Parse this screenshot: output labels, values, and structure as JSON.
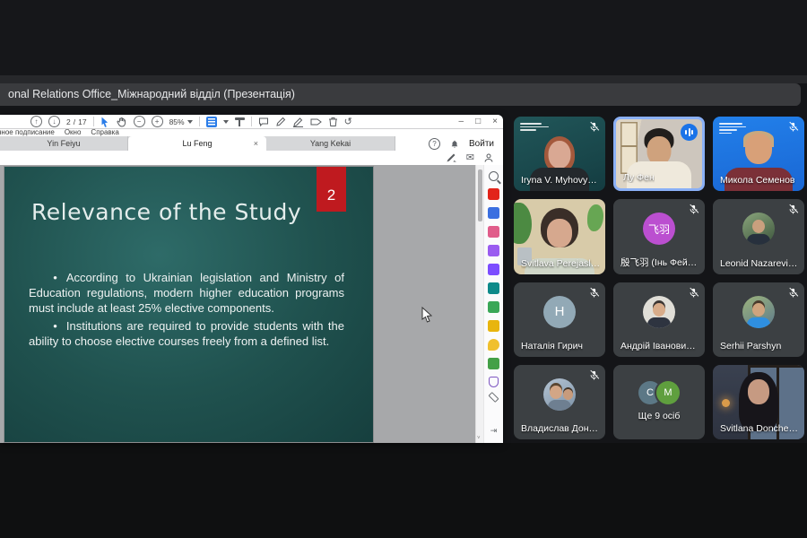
{
  "share_header": {
    "title": "onal Relations Office_Міжнародний відділ (Презентація)"
  },
  "acrobat": {
    "menu_items": [
      "нное подписание",
      "Окно",
      "Справка"
    ],
    "tabs": [
      {
        "label": "Yin Feiyu",
        "active": false
      },
      {
        "label": "Lu Feng",
        "active": true
      },
      {
        "label": "Yang Kekai",
        "active": false
      }
    ],
    "toolbar": {
      "page_current": "2",
      "page_separator": "/",
      "page_total": "17",
      "zoom_level": "85%"
    },
    "signin_label": "Войти",
    "glyphs": {
      "win_min": "–",
      "win_max": "□",
      "win_close": "×",
      "tab_close": "×",
      "help": "?",
      "page_up": "↑",
      "page_down": "↓",
      "zoom_out": "−",
      "zoom_in": "+",
      "undo": "↺",
      "envelope": "✉",
      "scroll_down": "˅",
      "rail_collapse": "⇥"
    },
    "right_rail_icons": [
      "search",
      "export-pdf",
      "create-pdf",
      "combine-files",
      "organize-pages",
      "fill-and-sign",
      "export-convert",
      "compress-pdf",
      "edit-pdf",
      "comments",
      "print-production",
      "protect",
      "measure"
    ]
  },
  "slide": {
    "page_badge": "2",
    "title": "Relevance of the Study",
    "bullet_char": "•",
    "bullets": [
      "According to Ukrainian legislation and Ministry of Education regulations, modern higher education programs must include at least 25% elective components.",
      "Institutions are required to provide students with the ability to choose elective courses freely from a defined list."
    ]
  },
  "participants": [
    {
      "name": "Iryna V. Myhovy…",
      "muted": true,
      "video": true
    },
    {
      "name": "Лу Фен",
      "muted": false,
      "speaking": true,
      "video": true,
      "accent": "#1a73e8",
      "border": "#8ab0f6"
    },
    {
      "name": "Микола Семенов",
      "muted": true,
      "video": true
    },
    {
      "name": "Svitlava Perejasl…",
      "muted": false,
      "video": true
    },
    {
      "name": "殷飞羽 (Інь Фей…",
      "muted": true,
      "video": false,
      "avatar_text": "飞羽",
      "avatar_color": "#bb4fd0"
    },
    {
      "name": "Leonid Nazarevi…",
      "muted": true,
      "video": false,
      "avatar_photo": true
    },
    {
      "name": "Наталія Гирич",
      "muted": true,
      "video": false,
      "avatar_text": "Н",
      "avatar_color": "#92a9b6"
    },
    {
      "name": "Андрій Іванови…",
      "muted": true,
      "video": false,
      "avatar_photo": true
    },
    {
      "name": "Serhii Parshyn",
      "muted": true,
      "video": false,
      "avatar_photo": true
    },
    {
      "name": "Владислав Дон…",
      "muted": true,
      "video": false,
      "avatar_photo": true
    },
    {
      "name": "Ще 9 осіб",
      "muted": false,
      "video": false,
      "avatar_stack": [
        "C",
        "M"
      ],
      "avatar_stack_colors": [
        "#5c7886",
        "#5f9f3e"
      ]
    },
    {
      "name": "Svitlana Donche…",
      "muted": false,
      "video": true
    }
  ]
}
